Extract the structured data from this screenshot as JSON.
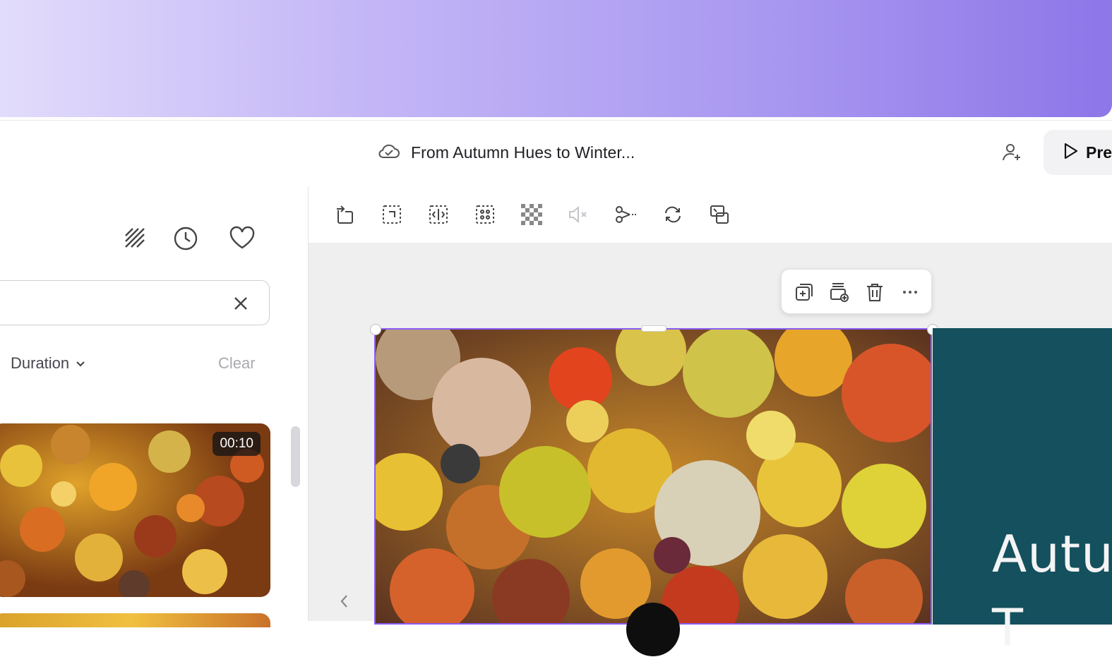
{
  "header": {
    "project_title": "From Autumn Hues to Winter...",
    "present_label": "Pre"
  },
  "sidebar": {
    "search_value": "",
    "filter_duration_label": "Duration",
    "filter_clear_label": "Clear",
    "results": [
      {
        "duration": "00:10"
      }
    ]
  },
  "canvas": {
    "slide_text_line1": "Autu",
    "slide_text_line2": "T"
  },
  "colors": {
    "accent": "#8a5cf6",
    "teal": "#14505d"
  }
}
